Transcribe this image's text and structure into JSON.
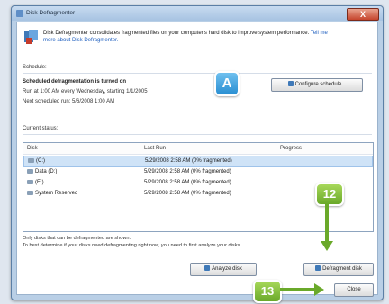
{
  "window": {
    "title": "Disk Defragmenter",
    "close_glyph": "X"
  },
  "intro": {
    "text": "Disk Defragmenter consolidates fragmented files on your computer's hard disk to improve system performance.",
    "link": "Tell me more about Disk Defragmenter."
  },
  "schedule": {
    "heading": "Schedule:",
    "status": "Scheduled defragmentation is turned on",
    "run_at": "Run at 1:00 AM every Wednesday, starting 1/1/2005",
    "next_run": "Next scheduled run: 5/6/2008 1:00 AM",
    "configure_label": "Configure schedule..."
  },
  "status": {
    "heading": "Current status:",
    "columns": [
      "Disk",
      "Last Run",
      "Progress"
    ],
    "rows": [
      {
        "disk": "(C:)",
        "last_run": "5/29/2008 2:58 AM (0% fragmented)",
        "selected": true
      },
      {
        "disk": "Data (D:)",
        "last_run": "5/29/2008 2:58 AM (0% fragmented)"
      },
      {
        "disk": "(E:)",
        "last_run": "5/29/2008 2:58 AM (0% fragmented)"
      },
      {
        "disk": "System Reserved",
        "last_run": "5/29/2008 2:58 AM (0% fragmented)"
      }
    ]
  },
  "note": {
    "line1": "Only disks that can be defragmented are shown.",
    "line2": "To best determine if your disks need defragmenting right now, you need to first analyze your disks."
  },
  "buttons": {
    "analyze": "Analyze disk",
    "defragment": "Defragment disk",
    "close": "Close"
  },
  "callouts": {
    "a": "A",
    "step12": "12",
    "step13": "13"
  }
}
